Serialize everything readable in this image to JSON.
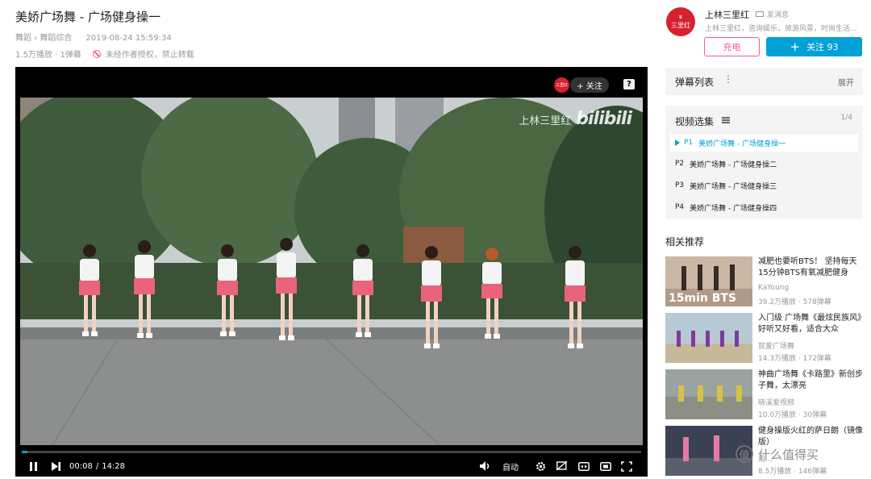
{
  "video": {
    "title": "美娇广场舞 - 广场健身操一",
    "category": "舞蹈 › 舞蹈综合",
    "date": "2019-08-24 15:59:34",
    "stats": "1.5万播放 · 1弹幕",
    "notice": "未经作者授权，禁止转载"
  },
  "player": {
    "up_badge": "三里红",
    "follow_label": "+ 关注",
    "help_label": "?",
    "watermark_name": "上林三里红",
    "watermark_brand": "bilibili",
    "current_time": "00:08",
    "separator": "/",
    "duration": "14:28",
    "progress_fraction": 0.0092,
    "quality_label": "自动",
    "accent_color": "#00a1d6"
  },
  "uploader": {
    "avatar_text": "三里红",
    "name": "上林三里红",
    "message_label": "发消息",
    "description": "上林三里红，咨询娱乐，旅游风景，时尚生活...",
    "charge_label": "充电",
    "follow_label": "关注 93"
  },
  "danmaku_panel": {
    "title": "弹幕列表",
    "dots": "⋮",
    "expand_label": "展开"
  },
  "episodes": {
    "title": "视频选集",
    "count": "1/4",
    "items": [
      {
        "num": "P1",
        "title": "美娇广场舞 - 广场健身操一",
        "active": true
      },
      {
        "num": "P2",
        "title": "美娇广场舞 - 广场健身操二",
        "active": false
      },
      {
        "num": "P3",
        "title": "美娇广场舞 - 广场健身操三",
        "active": false
      },
      {
        "num": "P4",
        "title": "美娇广场舞 - 广场健身操四",
        "active": false
      }
    ]
  },
  "recommendations": {
    "title": "相关推荐",
    "items": [
      {
        "title": "减肥也要听BTS！ 坚持每天15分钟BTS有氧减肥健身",
        "author": "KaYoung",
        "stats": "39.2万播放 · 578弹幕",
        "thumb_text": "15min BTS"
      },
      {
        "title": "入门级 广场舞《最炫民族风》好听又好看，适合大众",
        "author": "就爱广场舞",
        "stats": "14.3万播放 · 172弹幕",
        "thumb_text": ""
      },
      {
        "title": "神曲广场舞《卡路里》新创步子舞，太漂亮",
        "author": "晓溪爱视频",
        "stats": "10.0万播放 · 30弹幕",
        "thumb_text": ""
      },
      {
        "title": "健身操版火红的萨日朗（镜像版）",
        "author": "周...",
        "stats": "8.5万播放 · 146弹幕",
        "thumb_text": ""
      }
    ]
  },
  "watermark": {
    "text": "什么值得买",
    "icon": "值"
  }
}
